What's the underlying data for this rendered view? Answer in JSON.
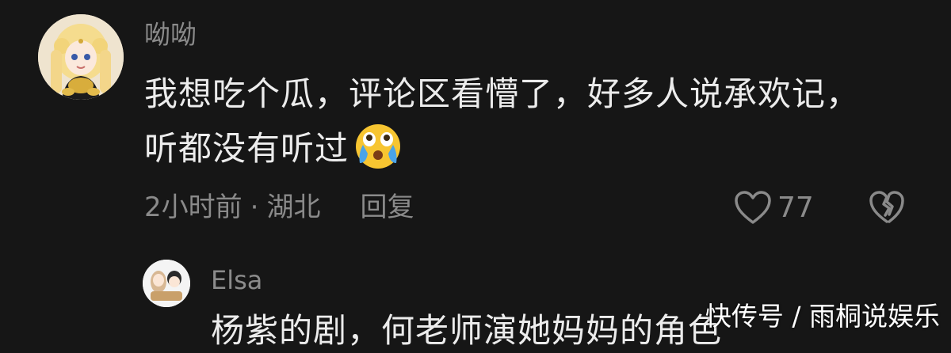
{
  "comment": {
    "username": "呦呦",
    "text_lines": [
      "我想吃个瓜，评论区看懵了，好多人说承欢记，",
      "听都没有听过"
    ],
    "emoji": "crying-laughing-emoji",
    "time": "2小时前",
    "separator": "·",
    "location": "湖北",
    "reply_label": "回复",
    "likes": "77"
  },
  "reply": {
    "username": "Elsa",
    "text": "杨紫的剧，何老师演她妈妈的角色"
  },
  "watermark": "快传号 / 雨桐说娱乐",
  "colors": {
    "background": "#161616",
    "primary_text": "#ececec",
    "secondary_text": "#8b8b8b",
    "emoji_yellow": "#f7c531",
    "emoji_tear": "#4aa3e8"
  }
}
